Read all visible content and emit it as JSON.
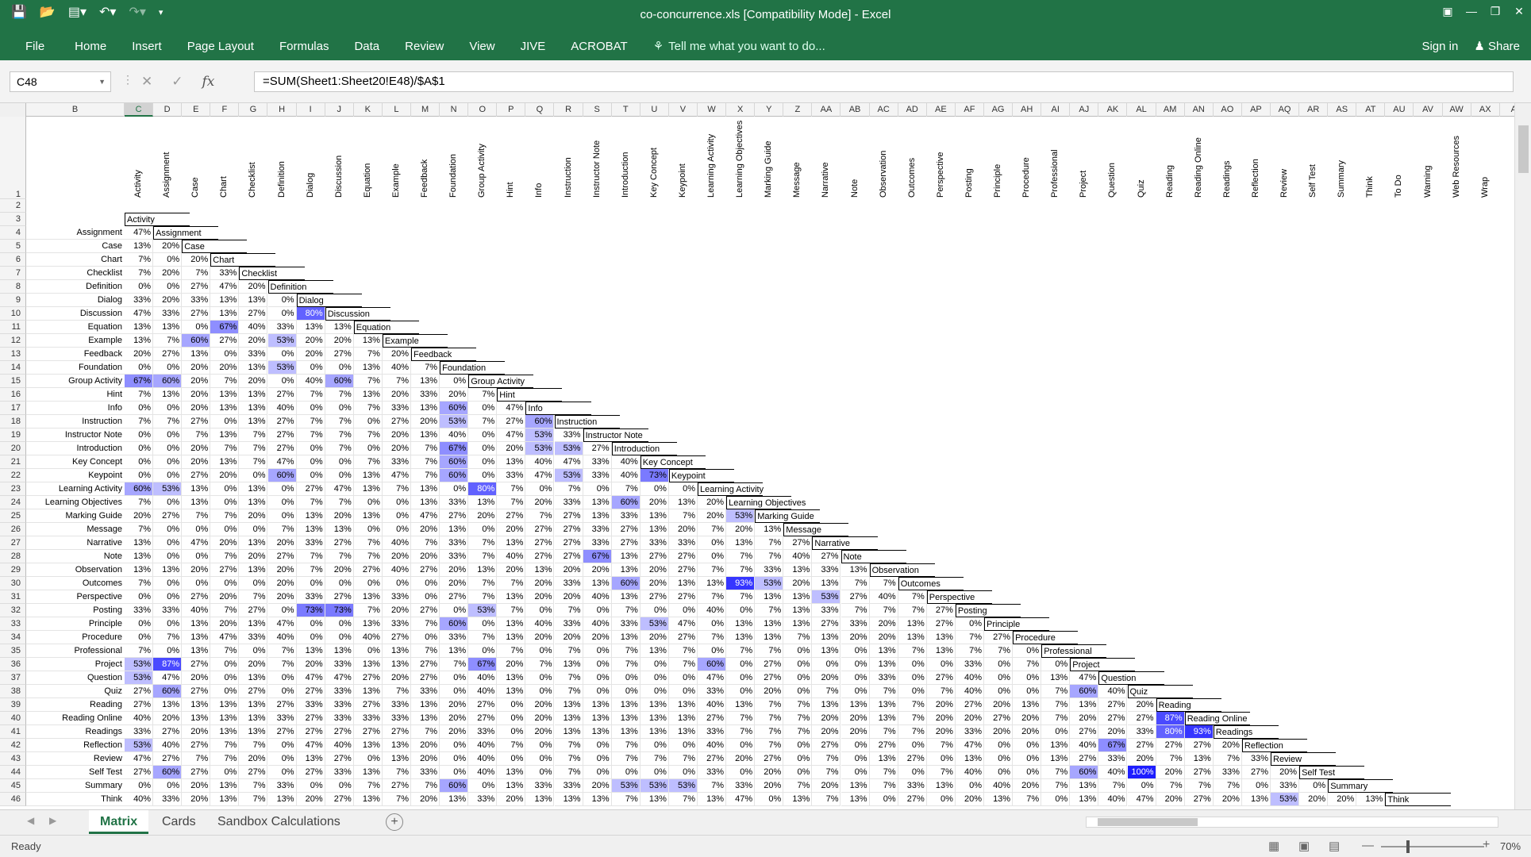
{
  "window": {
    "title": "co-concurrence.xls  [Compatibility Mode] - Excel",
    "qat": [
      "save-icon",
      "open-icon",
      "print-preview-icon",
      "undo-icon",
      "redo-icon",
      "customize-icon"
    ]
  },
  "ribbon": {
    "tabs": [
      "File",
      "Home",
      "Insert",
      "Page Layout",
      "Formulas",
      "Data",
      "Review",
      "View",
      "JIVE",
      "ACROBAT"
    ],
    "tell": "Tell me what you want to do...",
    "signin": "Sign in",
    "share": "Share"
  },
  "formula_bar": {
    "name_box": "C48",
    "formula": "=SUM(Sheet1:Sheet20!E48)/$A$1"
  },
  "columns": [
    "B",
    "C",
    "D",
    "E",
    "F",
    "G",
    "H",
    "I",
    "J",
    "K",
    "L",
    "M",
    "N",
    "O",
    "P",
    "Q",
    "R",
    "S",
    "T",
    "U",
    "V",
    "W",
    "X",
    "Y",
    "Z",
    "AA",
    "AB",
    "AC",
    "AD",
    "AE",
    "AF",
    "AG",
    "AH",
    "AI",
    "AJ",
    "AK",
    "AL",
    "AM",
    "AN",
    "AO",
    "AP",
    "AQ",
    "AR",
    "AS",
    "AT",
    "AU",
    "AV",
    "AW",
    "AX",
    "A"
  ],
  "categories": [
    "Activity",
    "Assignment",
    "Case",
    "Chart",
    "Checklist",
    "Definition",
    "Dialog",
    "Discussion",
    "Equation",
    "Example",
    "Feedback",
    "Foundation",
    "Group Activity",
    "Hint",
    "Info",
    "Instruction",
    "Instructor Note",
    "Introduction",
    "Key Concept",
    "Keypoint",
    "Learning Activity",
    "Learning Objectives",
    "Marking Guide",
    "Message",
    "Narrative",
    "Note",
    "Observation",
    "Outcomes",
    "Perspective",
    "Posting",
    "Principle",
    "Procedure",
    "Professional",
    "Project",
    "Question",
    "Quiz",
    "Reading",
    "Reading Online",
    "Readings",
    "Reflection",
    "Review",
    "Self Test",
    "Summary",
    "Think",
    "To Do",
    "Warning",
    "Web Resources",
    "Wrap"
  ],
  "matrix": [
    [],
    [
      47
    ],
    [
      13,
      20
    ],
    [
      7,
      0,
      20
    ],
    [
      7,
      20,
      7,
      33
    ],
    [
      0,
      0,
      27,
      47,
      20
    ],
    [
      33,
      20,
      33,
      13,
      13,
      0
    ],
    [
      47,
      33,
      27,
      13,
      27,
      0,
      80
    ],
    [
      13,
      13,
      0,
      67,
      40,
      33,
      13,
      13
    ],
    [
      13,
      7,
      60,
      27,
      20,
      53,
      20,
      20,
      13
    ],
    [
      20,
      27,
      13,
      0,
      33,
      0,
      20,
      27,
      7,
      20
    ],
    [
      0,
      0,
      20,
      20,
      13,
      53,
      0,
      0,
      13,
      40,
      7
    ],
    [
      67,
      60,
      20,
      7,
      20,
      0,
      40,
      60,
      7,
      7,
      13,
      0
    ],
    [
      7,
      13,
      20,
      13,
      13,
      27,
      7,
      7,
      13,
      20,
      33,
      20,
      7
    ],
    [
      0,
      0,
      20,
      13,
      13,
      40,
      0,
      0,
      7,
      33,
      13,
      60,
      0,
      47
    ],
    [
      7,
      7,
      27,
      0,
      13,
      27,
      7,
      7,
      0,
      27,
      20,
      53,
      7,
      27,
      60
    ],
    [
      0,
      0,
      7,
      13,
      7,
      27,
      7,
      7,
      7,
      20,
      13,
      40,
      0,
      47,
      53,
      33
    ],
    [
      0,
      0,
      20,
      7,
      7,
      27,
      0,
      7,
      0,
      20,
      7,
      67,
      0,
      20,
      53,
      53,
      27
    ],
    [
      0,
      0,
      20,
      13,
      7,
      47,
      0,
      0,
      7,
      33,
      7,
      60,
      0,
      13,
      40,
      47,
      33,
      40
    ],
    [
      0,
      0,
      27,
      20,
      0,
      60,
      0,
      0,
      13,
      47,
      7,
      60,
      0,
      33,
      47,
      53,
      33,
      40,
      73
    ],
    [
      60,
      53,
      13,
      0,
      13,
      0,
      27,
      47,
      13,
      7,
      13,
      0,
      80,
      7,
      0,
      7,
      0,
      7,
      0,
      0
    ],
    [
      7,
      0,
      13,
      0,
      13,
      0,
      7,
      7,
      0,
      0,
      13,
      33,
      13,
      7,
      20,
      33,
      13,
      60,
      20,
      13,
      20
    ],
    [
      20,
      27,
      7,
      7,
      20,
      0,
      13,
      20,
      13,
      0,
      47,
      27,
      20,
      27,
      7,
      27,
      13,
      33,
      13,
      7,
      20,
      53
    ],
    [
      7,
      0,
      0,
      0,
      0,
      7,
      13,
      13,
      0,
      0,
      20,
      13,
      0,
      20,
      27,
      27,
      33,
      27,
      13,
      20,
      7,
      20,
      13
    ],
    [
      13,
      0,
      47,
      20,
      13,
      20,
      33,
      27,
      7,
      40,
      7,
      33,
      7,
      13,
      27,
      27,
      33,
      27,
      33,
      33,
      0,
      13,
      7,
      27
    ],
    [
      13,
      0,
      0,
      7,
      20,
      27,
      7,
      7,
      7,
      20,
      20,
      33,
      7,
      40,
      27,
      27,
      67,
      13,
      27,
      27,
      0,
      7,
      7,
      40,
      27
    ],
    [
      13,
      13,
      20,
      27,
      13,
      20,
      7,
      20,
      27,
      40,
      27,
      20,
      13,
      20,
      13,
      20,
      20,
      13,
      20,
      27,
      7,
      7,
      33,
      13,
      33,
      13
    ],
    [
      7,
      0,
      0,
      0,
      0,
      20,
      0,
      0,
      0,
      0,
      0,
      20,
      7,
      7,
      20,
      33,
      13,
      60,
      20,
      13,
      13,
      93,
      53,
      20,
      13,
      7,
      7
    ],
    [
      0,
      0,
      27,
      20,
      7,
      20,
      33,
      27,
      13,
      33,
      0,
      27,
      7,
      13,
      20,
      20,
      40,
      13,
      27,
      27,
      7,
      7,
      13,
      13,
      53,
      27,
      40,
      7
    ],
    [
      33,
      33,
      40,
      7,
      27,
      0,
      73,
      73,
      7,
      20,
      27,
      0,
      53,
      7,
      0,
      7,
      0,
      7,
      0,
      0,
      40,
      0,
      7,
      13,
      33,
      7,
      7,
      7,
      27
    ],
    [
      0,
      0,
      13,
      20,
      13,
      47,
      0,
      0,
      13,
      33,
      7,
      60,
      0,
      13,
      40,
      33,
      40,
      33,
      53,
      47,
      0,
      13,
      13,
      13,
      27,
      33,
      20,
      13,
      27,
      0
    ],
    [
      0,
      7,
      13,
      47,
      33,
      40,
      0,
      0,
      40,
      27,
      0,
      33,
      7,
      13,
      20,
      20,
      20,
      13,
      20,
      27,
      7,
      13,
      13,
      7,
      13,
      20,
      20,
      13,
      13,
      7,
      27
    ],
    [
      7,
      0,
      13,
      7,
      0,
      7,
      13,
      13,
      0,
      13,
      7,
      13,
      0,
      7,
      0,
      7,
      0,
      7,
      13,
      7,
      0,
      7,
      7,
      0,
      13,
      0,
      13,
      7,
      13,
      7,
      7,
      0
    ],
    [
      53,
      87,
      27,
      0,
      20,
      7,
      20,
      33,
      13,
      13,
      27,
      7,
      67,
      20,
      7,
      13,
      0,
      7,
      0,
      7,
      60,
      0,
      27,
      0,
      0,
      0,
      13,
      0,
      0,
      33,
      0,
      7,
      0
    ],
    [
      53,
      47,
      20,
      0,
      13,
      0,
      47,
      47,
      27,
      20,
      27,
      0,
      40,
      13,
      0,
      7,
      0,
      0,
      0,
      0,
      47,
      0,
      27,
      0,
      20,
      0,
      33,
      0,
      27,
      40,
      0,
      0,
      13,
      47
    ],
    [
      27,
      60,
      27,
      0,
      27,
      0,
      27,
      33,
      13,
      7,
      33,
      0,
      40,
      13,
      0,
      7,
      0,
      0,
      0,
      0,
      33,
      0,
      20,
      0,
      7,
      0,
      7,
      0,
      7,
      40,
      0,
      0,
      7,
      60,
      40
    ],
    [
      27,
      13,
      13,
      13,
      13,
      27,
      33,
      33,
      27,
      33,
      13,
      20,
      27,
      0,
      20,
      13,
      13,
      13,
      13,
      13,
      40,
      13,
      7,
      7,
      13,
      13,
      13,
      7,
      20,
      27,
      20,
      13,
      7,
      13,
      27,
      20
    ],
    [
      40,
      20,
      13,
      13,
      13,
      33,
      27,
      33,
      33,
      33,
      13,
      20,
      27,
      0,
      20,
      13,
      13,
      13,
      13,
      13,
      27,
      7,
      7,
      7,
      20,
      20,
      13,
      7,
      20,
      20,
      27,
      20,
      7,
      20,
      27,
      27,
      87
    ],
    [
      33,
      27,
      20,
      13,
      13,
      27,
      27,
      27,
      27,
      27,
      7,
      20,
      33,
      0,
      20,
      13,
      13,
      13,
      13,
      13,
      33,
      7,
      7,
      7,
      20,
      20,
      7,
      7,
      20,
      33,
      20,
      20,
      0,
      27,
      20,
      33,
      80,
      93
    ],
    [
      53,
      40,
      27,
      7,
      7,
      0,
      47,
      40,
      13,
      13,
      20,
      0,
      40,
      7,
      0,
      7,
      0,
      7,
      0,
      0,
      40,
      0,
      7,
      0,
      27,
      0,
      27,
      0,
      7,
      47,
      0,
      0,
      13,
      40,
      67,
      27,
      27,
      27,
      20
    ],
    [
      47,
      27,
      7,
      7,
      20,
      0,
      13,
      27,
      0,
      13,
      20,
      0,
      40,
      0,
      0,
      7,
      0,
      7,
      7,
      7,
      27,
      20,
      27,
      0,
      7,
      0,
      13,
      27,
      0,
      13,
      0,
      0,
      13,
      27,
      33,
      20,
      7,
      13,
      7,
      33
    ],
    [
      27,
      60,
      27,
      0,
      27,
      0,
      27,
      33,
      13,
      7,
      33,
      0,
      40,
      13,
      0,
      7,
      0,
      0,
      0,
      0,
      33,
      0,
      20,
      0,
      7,
      0,
      7,
      0,
      7,
      40,
      0,
      0,
      7,
      60,
      40,
      100,
      20,
      27,
      33,
      27,
      20
    ],
    [
      0,
      0,
      20,
      13,
      7,
      33,
      0,
      0,
      7,
      27,
      7,
      60,
      0,
      13,
      33,
      33,
      20,
      53,
      53,
      53,
      7,
      33,
      20,
      7,
      20,
      13,
      7,
      33,
      13,
      0,
      40,
      20,
      7,
      13,
      7,
      0,
      7,
      7,
      7,
      0,
      33,
      0
    ],
    [
      40,
      33,
      20,
      13,
      7,
      13,
      20,
      27,
      13,
      7,
      20,
      13,
      33,
      20,
      13,
      13,
      13,
      7,
      13,
      7,
      13,
      47,
      0,
      13,
      7,
      13,
      0,
      27,
      0,
      20,
      13,
      7,
      0,
      13,
      40,
      47,
      20,
      27,
      20,
      13,
      53,
      20,
      20,
      13
    ]
  ]
}
